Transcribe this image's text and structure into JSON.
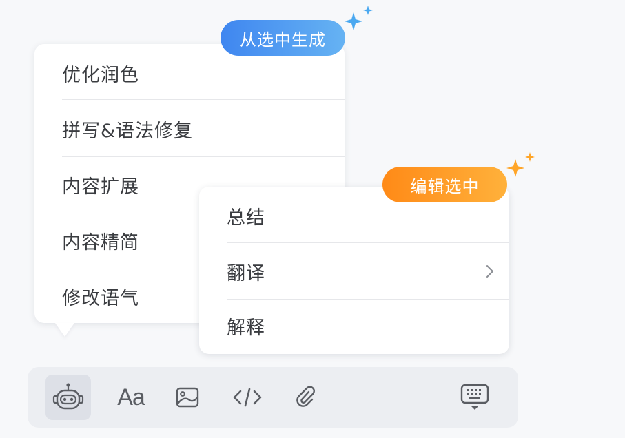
{
  "generate_menu": {
    "badge": "从选中生成",
    "items": [
      {
        "label": "优化润色"
      },
      {
        "label": "拼写&语法修复"
      },
      {
        "label": "内容扩展"
      },
      {
        "label": "内容精简"
      },
      {
        "label": "修改语气"
      }
    ]
  },
  "edit_menu": {
    "badge": "编辑选中",
    "items": [
      {
        "label": "总结",
        "has_submenu": false
      },
      {
        "label": "翻译",
        "has_submenu": true
      },
      {
        "label": "解释",
        "has_submenu": false
      }
    ]
  },
  "toolbar": {
    "tools": [
      {
        "icon": "robot-icon",
        "active": true
      },
      {
        "icon": "font-icon",
        "label": "Aa"
      },
      {
        "icon": "image-icon"
      },
      {
        "icon": "code-icon"
      },
      {
        "icon": "paperclip-icon"
      },
      {
        "icon": "keyboard-hide-icon"
      }
    ]
  },
  "colors": {
    "generate_badge_start": "#3f86f0",
    "generate_badge_end": "#66b3f3",
    "edit_badge_start": "#ff8a17",
    "edit_badge_end": "#ffb13b",
    "sparkle_blue": "#4aa8f0",
    "sparkle_orange": "#ffa528",
    "icon": "#5a5d63"
  }
}
